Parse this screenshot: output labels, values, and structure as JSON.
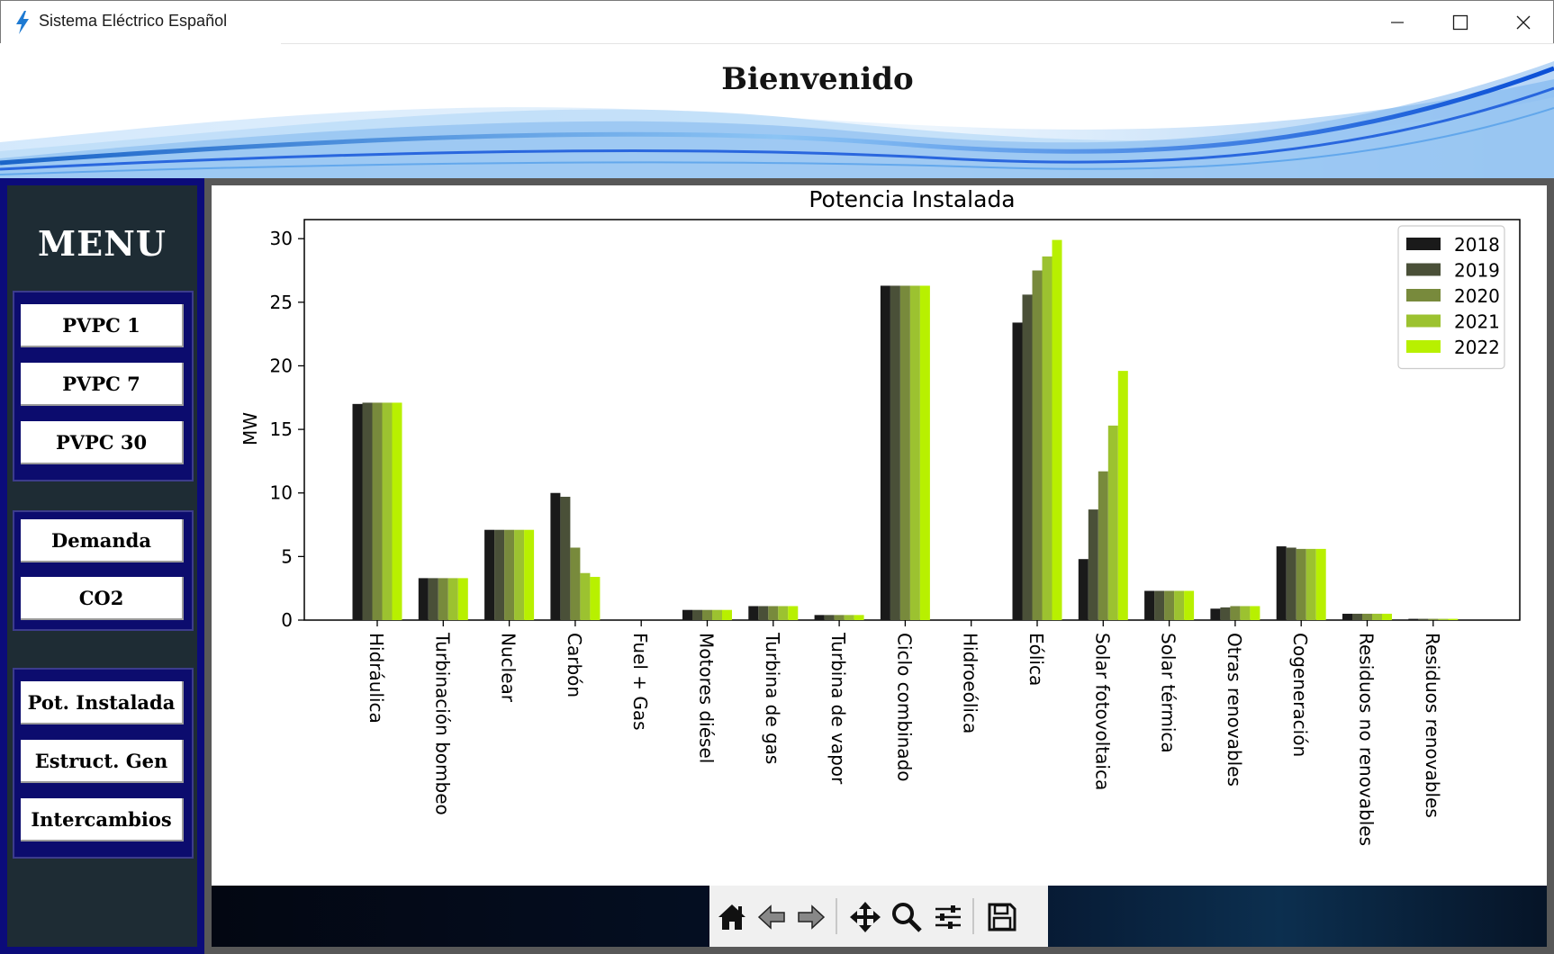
{
  "window": {
    "title": "Sistema Eléctrico Español",
    "controls": [
      "minimize-icon",
      "maximize-icon",
      "close-icon"
    ]
  },
  "header": {
    "title": "Bienvenido"
  },
  "sidebar": {
    "title": "MENU",
    "groups": [
      {
        "buttons": [
          {
            "label": "PVPC 1"
          },
          {
            "label": "PVPC 7"
          },
          {
            "label": "PVPC 30"
          }
        ]
      },
      {
        "buttons": [
          {
            "label": "Demanda"
          },
          {
            "label": "CO2"
          }
        ]
      },
      {
        "buttons": [
          {
            "label": "Pot. Instalada"
          },
          {
            "label": "Estruct. Gen"
          },
          {
            "label": "Intercambios"
          }
        ]
      }
    ]
  },
  "toolbar": {
    "icons": [
      "home-icon",
      "back-arrow-icon",
      "forward-arrow-icon",
      "pan-icon",
      "zoom-icon",
      "configure-subplots-icon",
      "save-icon"
    ]
  },
  "colors": {
    "sidebar_border": "#0b0b7a",
    "sidebar_bg": "#1e2c34",
    "series": [
      "#1a1a1a",
      "#4a5038",
      "#788a3c",
      "#9cc230",
      "#b8f000"
    ]
  },
  "chart_data": {
    "type": "bar",
    "title": "Potencia Instalada",
    "xlabel": "",
    "ylabel": "MW",
    "ylim": [
      0,
      31.5
    ],
    "yticks": [
      0,
      5,
      10,
      15,
      20,
      25,
      30
    ],
    "grid": false,
    "legend_position": "top-right",
    "categories": [
      "Hidráulica",
      "Turbinación bombeo",
      "Nuclear",
      "Carbón",
      "Fuel + Gas",
      "Motores diésel",
      "Turbina de gas",
      "Turbina de vapor",
      "Ciclo combinado",
      "Hidroeólica",
      "Eólica",
      "Solar fotovoltaica",
      "Solar térmica",
      "Otras renovables",
      "Cogeneración",
      "Residuos no renovables",
      "Residuos renovables"
    ],
    "series": [
      {
        "name": "2018",
        "color": "#1a1a1a",
        "values": [
          17.0,
          3.3,
          7.1,
          10.0,
          0.0,
          0.8,
          1.1,
          0.4,
          26.3,
          0.0,
          23.4,
          4.8,
          2.3,
          0.9,
          5.8,
          0.5,
          0.1
        ]
      },
      {
        "name": "2019",
        "color": "#4a5038",
        "values": [
          17.1,
          3.3,
          7.1,
          9.7,
          0.0,
          0.8,
          1.1,
          0.4,
          26.3,
          0.0,
          25.6,
          8.7,
          2.3,
          1.0,
          5.7,
          0.5,
          0.1
        ]
      },
      {
        "name": "2020",
        "color": "#788a3c",
        "values": [
          17.1,
          3.3,
          7.1,
          5.7,
          0.0,
          0.8,
          1.1,
          0.4,
          26.3,
          0.0,
          27.5,
          11.7,
          2.3,
          1.1,
          5.6,
          0.5,
          0.1
        ]
      },
      {
        "name": "2021",
        "color": "#9cc230",
        "values": [
          17.1,
          3.3,
          7.1,
          3.7,
          0.0,
          0.8,
          1.1,
          0.4,
          26.3,
          0.0,
          28.6,
          15.3,
          2.3,
          1.1,
          5.6,
          0.5,
          0.1
        ]
      },
      {
        "name": "2022",
        "color": "#b8f000",
        "values": [
          17.1,
          3.3,
          7.1,
          3.4,
          0.0,
          0.8,
          1.1,
          0.4,
          26.3,
          0.0,
          29.9,
          19.6,
          2.3,
          1.1,
          5.6,
          0.5,
          0.1
        ]
      }
    ]
  }
}
